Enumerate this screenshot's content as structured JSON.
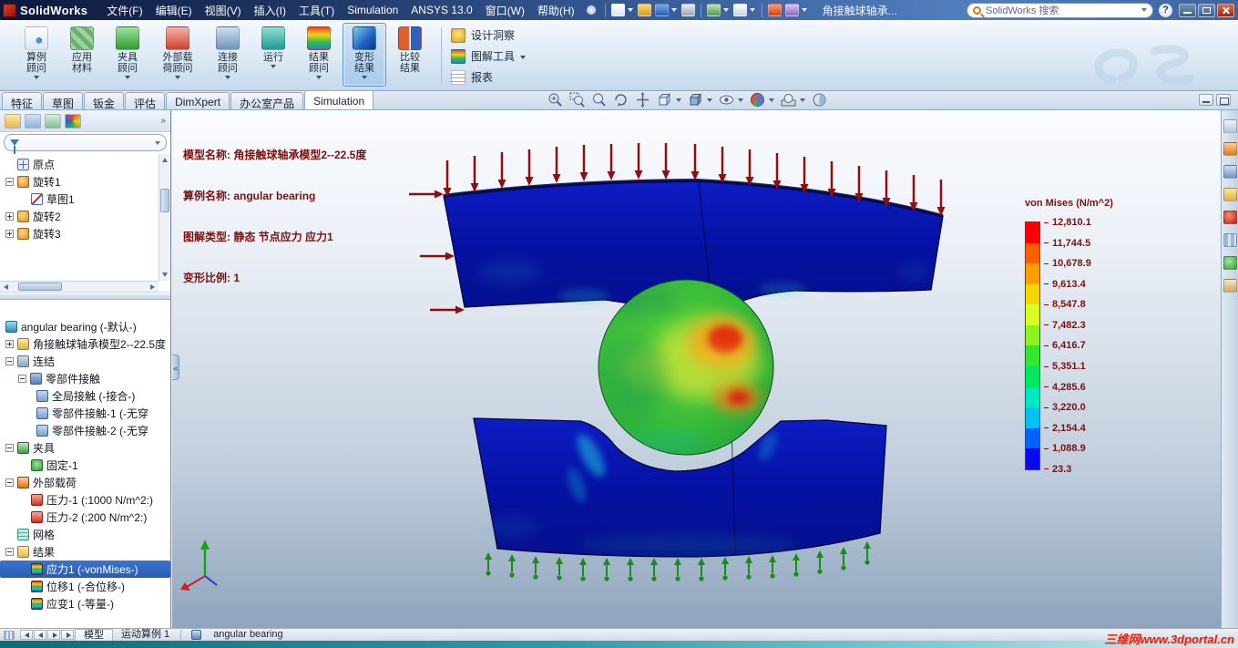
{
  "titlebar": {
    "app": "SolidWorks",
    "doc": "角接触球轴承...",
    "search": "SolidWorks 搜索"
  },
  "menu": {
    "items": [
      "文件(F)",
      "编辑(E)",
      "视图(V)",
      "插入(I)",
      "工具(T)",
      "Simulation",
      "ANSYS 13.0",
      "窗口(W)",
      "帮助(H)"
    ]
  },
  "ribbon": {
    "buttons": [
      "算例顾问",
      "应用材料",
      "夹具顾问",
      "外部载荷顾问",
      "连接顾问",
      "运行",
      "结果顾问",
      "变形结果",
      "比较结果"
    ],
    "tools": [
      "设计洞察",
      "图解工具",
      "报表"
    ]
  },
  "tabs": {
    "items": [
      "特征",
      "草图",
      "钣金",
      "评估",
      "DimXpert",
      "办公室产品",
      "Simulation"
    ]
  },
  "feature_tree": {
    "items": [
      "原点",
      "旋转1",
      "草图1",
      "旋转2",
      "旋转3"
    ]
  },
  "sim_tree": {
    "items": [
      "angular bearing (-默认-)",
      "角接触球轴承模型2--22.5度",
      "连结",
      "零部件接触",
      "全局接触 (-接合-)",
      "零部件接触-1 (-无穿",
      "零部件接触-2 (-无穿",
      "夹具",
      "固定-1",
      "外部载荷",
      "压力-1 (:1000 N/m^2:)",
      "压力-2 (:200 N/m^2:)",
      "网格",
      "结果",
      "应力1 (-vonMises-)",
      "位移1 (-合位移-)",
      "应变1 (-等量-)"
    ],
    "selected": "应力1 (-vonMises-)"
  },
  "viewport": {
    "annotation": [
      "模型名称: 角接触球轴承模型2--22.5度",
      "算例名称: angular bearing",
      "图解类型: 静态 节点应力 应力1",
      "变形比例: 1"
    ]
  },
  "legend": {
    "title": "von Mises (N/m^2)",
    "values": [
      "12,810.1",
      "11,744.5",
      "10,678.9",
      "9,613.4",
      "8,547.8",
      "7,482.3",
      "6,416.7",
      "5,351.1",
      "4,285.6",
      "3,220.0",
      "2,154.4",
      "1,088.9",
      "23.3"
    ],
    "colors": [
      "#fe0000",
      "#fd5f00",
      "#ff9e00",
      "#f6d500",
      "#d8ff22",
      "#8cf322",
      "#31e831",
      "#00e95d",
      "#00e8c2",
      "#00c2f2",
      "#0062fe",
      "#0a0af0"
    ],
    "max_color": "#fe0000",
    "min_color": "#0a0af0"
  },
  "statusbar": {
    "tabs": [
      "模型",
      "运动算例 1",
      "angular bearing"
    ],
    "watermark": "三维网www.3dportal.cn"
  }
}
